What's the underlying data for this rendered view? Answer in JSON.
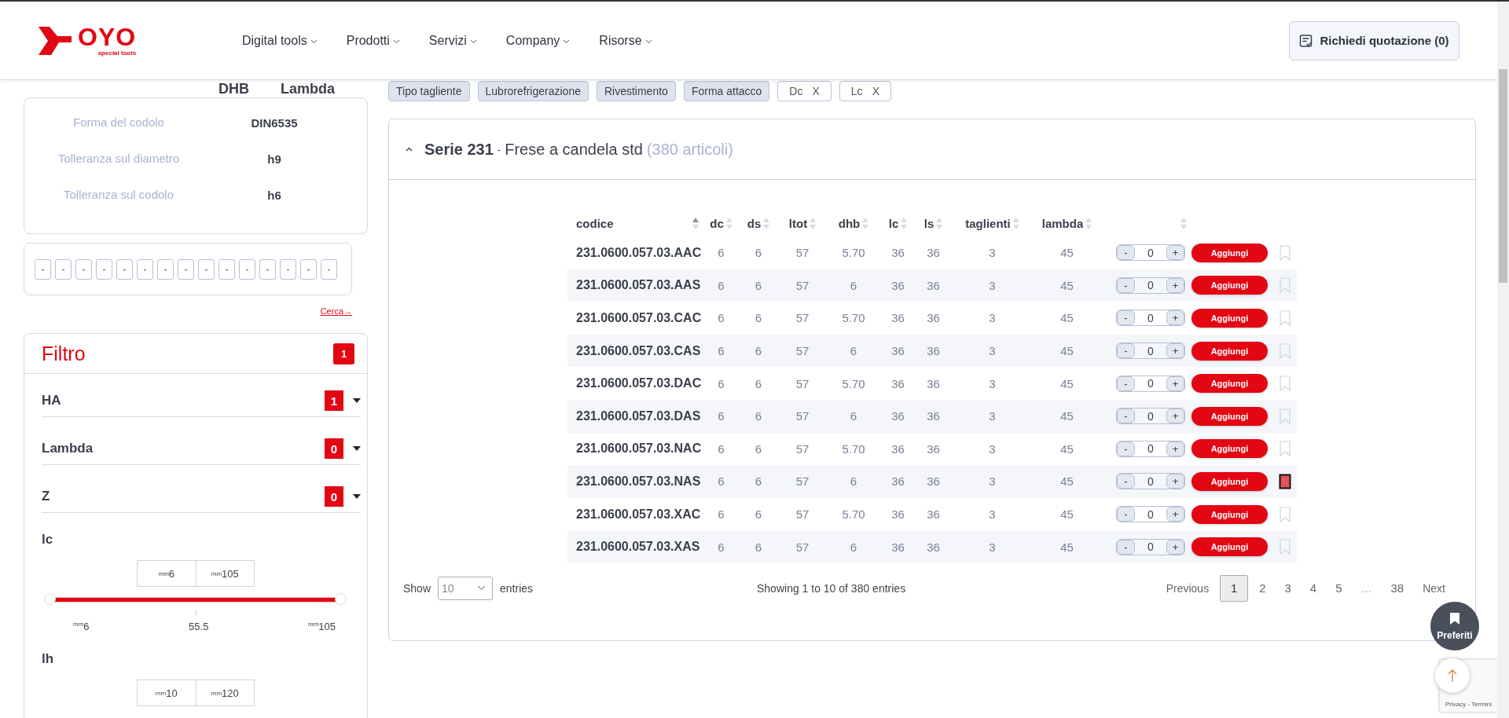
{
  "header": {
    "logo": {
      "wordmark": "OYO",
      "tagline": "special tools"
    },
    "nav": [
      {
        "label": "Digital tools"
      },
      {
        "label": "Prodotti"
      },
      {
        "label": "Servizi"
      },
      {
        "label": "Company"
      },
      {
        "label": "Risorse"
      }
    ],
    "quote_button": "Richiedi quotazione (0)"
  },
  "sidebar": {
    "column_headers": [
      "DHB",
      "Lambda"
    ],
    "specs": [
      {
        "label": "Forma del codolo",
        "value": "DIN6535"
      },
      {
        "label": "Tolleranza sul diametro",
        "value": "h9"
      },
      {
        "label": "Tolleranza sul codolo",
        "value": "h6"
      }
    ],
    "code_segments": [
      "-",
      "-",
      "-",
      "-",
      "-",
      "-",
      "-",
      "-",
      "-",
      "-",
      "-",
      "-",
      "-",
      "-",
      "-"
    ],
    "search_link": "Cerca→",
    "filter": {
      "title": "Filtro",
      "count": "1",
      "groups": [
        {
          "label": "HA",
          "count": "1"
        },
        {
          "label": "Lambda",
          "count": "0"
        },
        {
          "label": "Z",
          "count": "0"
        }
      ],
      "ranges": [
        {
          "label": "lc",
          "from": "$^{mm}$6",
          "to": "$^{mm}$105",
          "min": "$^{mm}$6",
          "mid": "55.5",
          "max": "$^{mm}$105",
          "thumbs": [
            {
              "level": 0
            },
            {
              "level": 1
            }
          ]
        },
        {
          "label": "lh",
          "from": "$^{mm}$10",
          "to": "$^{mm}$120"
        }
      ]
    }
  },
  "chips": [
    {
      "label": "Tipo tagliente",
      "kind": "facet"
    },
    {
      "label": "Lubrorefrigerazione",
      "kind": "facet"
    },
    {
      "label": "Rivestimento",
      "kind": "facet"
    },
    {
      "label": "Forma attacco",
      "kind": "facet"
    },
    {
      "label": "Dc",
      "remove": "X",
      "kind": "active"
    },
    {
      "label": "Lc",
      "remove": "X",
      "kind": "active"
    }
  ],
  "series": {
    "title": "Serie 231",
    "separator": "-",
    "subtitle": "Frese a candela std",
    "count": "(380 articoli)",
    "expanded": true,
    "table": {
      "columns": [
        {
          "label": "codice",
          "sorted": true
        },
        {
          "label": "dc",
          "sorted": false
        },
        {
          "label": "ds",
          "sorted": false
        },
        {
          "label": "ltot",
          "sorted": false
        },
        {
          "label": "dhb",
          "sorted": false
        },
        {
          "label": "lc",
          "sorted": false
        },
        {
          "label": "ls",
          "sorted": false
        },
        {
          "label": "taglienti",
          "sorted": false
        },
        {
          "label": "lambda",
          "sorted": false
        },
        {
          "sorted": false
        }
      ],
      "rows": [
        {
          "cells": [
            "231.0600.057.03.AAC",
            "6",
            "6",
            "57",
            "5.70",
            "36",
            "36",
            "3",
            "45"
          ],
          "minus": "-",
          "quantity": "0",
          "plus": "+",
          "add": "Aggiungi",
          "favorite": false
        },
        {
          "cells": [
            "231.0600.057.03.AAS",
            "6",
            "6",
            "57",
            "6",
            "36",
            "36",
            "3",
            "45"
          ],
          "minus": "-",
          "quantity": "0",
          "plus": "+",
          "add": "Aggiungi",
          "favorite": false
        },
        {
          "cells": [
            "231.0600.057.03.CAC",
            "6",
            "6",
            "57",
            "5.70",
            "36",
            "36",
            "3",
            "45"
          ],
          "minus": "-",
          "quantity": "0",
          "plus": "+",
          "add": "Aggiungi",
          "favorite": false
        },
        {
          "cells": [
            "231.0600.057.03.CAS",
            "6",
            "6",
            "57",
            "6",
            "36",
            "36",
            "3",
            "45"
          ],
          "minus": "-",
          "quantity": "0",
          "plus": "+",
          "add": "Aggiungi",
          "favorite": false
        },
        {
          "cells": [
            "231.0600.057.03.DAC",
            "6",
            "6",
            "57",
            "5.70",
            "36",
            "36",
            "3",
            "45"
          ],
          "minus": "-",
          "quantity": "0",
          "plus": "+",
          "add": "Aggiungi",
          "favorite": false
        },
        {
          "cells": [
            "231.0600.057.03.DAS",
            "6",
            "6",
            "57",
            "6",
            "36",
            "36",
            "3",
            "45"
          ],
          "minus": "-",
          "quantity": "0",
          "plus": "+",
          "add": "Aggiungi",
          "favorite": false
        },
        {
          "cells": [
            "231.0600.057.03.NAC",
            "6",
            "6",
            "57",
            "5.70",
            "36",
            "36",
            "3",
            "45"
          ],
          "minus": "-",
          "quantity": "0",
          "plus": "+",
          "add": "Aggiungi",
          "favorite": false
        },
        {
          "cells": [
            "231.0600.057.03.NAS",
            "6",
            "6",
            "57",
            "6",
            "36",
            "36",
            "3",
            "45"
          ],
          "minus": "-",
          "quantity": "0",
          "plus": "+",
          "add": "Aggiungi",
          "favorite": true
        },
        {
          "cells": [
            "231.0600.057.03.XAC",
            "6",
            "6",
            "57",
            "5.70",
            "36",
            "36",
            "3",
            "45"
          ],
          "minus": "-",
          "quantity": "0",
          "plus": "+",
          "add": "Aggiungi",
          "favorite": false
        },
        {
          "cells": [
            "231.0600.057.03.XAS",
            "6",
            "6",
            "57",
            "6",
            "36",
            "36",
            "3",
            "45"
          ],
          "minus": "-",
          "quantity": "0",
          "plus": "+",
          "add": "Aggiungi",
          "favorite": false
        }
      ]
    },
    "footer": {
      "show_label": "Show",
      "page_size": "10",
      "entries_label": "entries",
      "info": "Showing 1 to 10 of 380 entries",
      "pagination": {
        "previous": "Previous",
        "next": "Next",
        "pages": [
          {
            "label": "1",
            "kind": "page",
            "selected": true
          },
          {
            "label": "2",
            "kind": "page",
            "selected": false
          },
          {
            "label": "3",
            "kind": "page",
            "selected": false
          },
          {
            "label": "4",
            "kind": "page",
            "selected": false
          },
          {
            "label": "5",
            "kind": "page",
            "selected": false
          },
          {
            "label": "…",
            "kind": "ellipsis"
          },
          {
            "label": "38",
            "kind": "page",
            "selected": false
          }
        ]
      }
    }
  },
  "floating": {
    "favorites_button": "Preferiti",
    "recaptcha": "Privacy - Termini"
  }
}
